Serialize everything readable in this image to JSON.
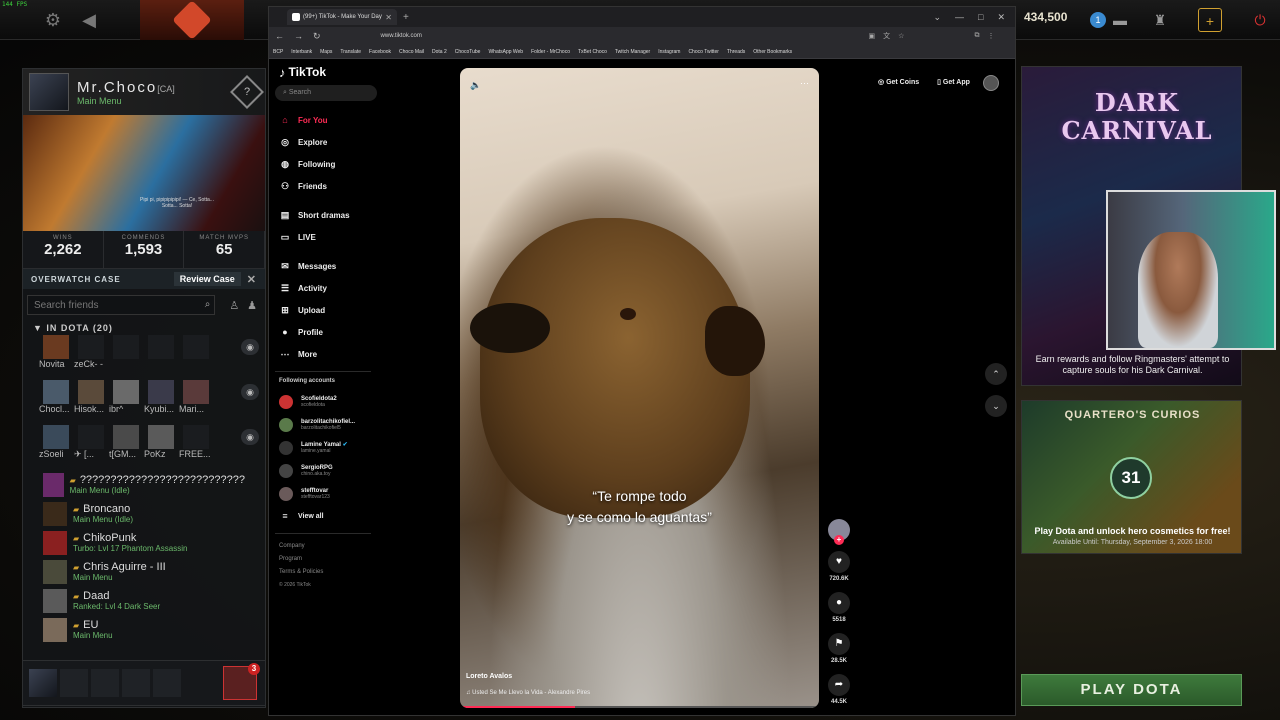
{
  "fps": "144 FPS",
  "dota": {
    "gold": "434,500",
    "party_count": "1",
    "profile": {
      "name": "Mr.Choco",
      "tag": "[CA]",
      "status": "Main Menu",
      "rank": "?"
    },
    "banner_text": "Pipi pi, pipipipipipi! — Ce, Sotta... Sotta... Sotta!",
    "stats": [
      {
        "label": "WINS",
        "value": "2,262"
      },
      {
        "label": "COMMENDS",
        "value": "1,593"
      },
      {
        "label": "MATCH MVPS",
        "value": "65"
      }
    ],
    "overwatch": {
      "label": "OVERWATCH CASE",
      "button": "Review Case"
    },
    "search_placeholder": "Search friends",
    "in_dota": "IN DOTA (20)",
    "grid_rows": [
      [
        "Novita",
        "zeCk- -",
        "",
        "",
        ""
      ],
      [
        "Chocl...",
        "Hisok...",
        "ibr^",
        "Kyubi...",
        "Mari..."
      ],
      [
        "zSoeli",
        "✈ [...",
        "t[GM...",
        "PoKz",
        "FREE..."
      ]
    ],
    "friends": [
      {
        "name": "???????????????????????????",
        "status": "Main Menu (Idle)"
      },
      {
        "name": "Broncano",
        "status": "Main Menu (Idle)"
      },
      {
        "name": "ChikoPunk",
        "status": "Turbo: Lvl 17 Phantom Assassin"
      },
      {
        "name": "Chris Aguirre - III",
        "status": "Main Menu"
      },
      {
        "name": "Daad",
        "status": "Ranked: Lvl 4 Dark Seer"
      },
      {
        "name": "EU",
        "status": "Main Menu"
      }
    ],
    "party_badge": "3",
    "carnival": {
      "title": "DARK CARNIVAL",
      "subtitle": "Earn rewards and follow Ringmasters' attempt to capture souls for his Dark Carnival."
    },
    "curios": {
      "title": "QUARTERO'S CURIOS",
      "badge": "31",
      "desc": "Play Dota and unlock hero cosmetics for free!",
      "available": "Available Until: Thursday, September 3, 2026 18:00"
    },
    "play_button": "PLAY DOTA"
  },
  "browser": {
    "tab_title": "(99+) TikTok - Make Your Day",
    "url": "www.tiktok.com",
    "bookmarks": [
      "BCP",
      "Interbank",
      "Maps",
      "Translate",
      "Facebook",
      "Choco Mail",
      "Dota 2",
      "ChocoTube",
      "WhatsApp Web",
      "Folder - MrChoco",
      "TxBet Choco",
      "Twitch Manager",
      "Instagram",
      "Choco Twitter",
      "Threads",
      "Other Bookmarks"
    ]
  },
  "tiktok": {
    "logo": "TikTok",
    "search_placeholder": "Search",
    "nav": [
      {
        "label": "For You",
        "icon": "home-icon"
      },
      {
        "label": "Explore",
        "icon": "compass-icon"
      },
      {
        "label": "Following",
        "icon": "following-icon"
      },
      {
        "label": "Friends",
        "icon": "friends-icon"
      },
      {
        "label": "Short dramas",
        "icon": "drama-icon"
      },
      {
        "label": "LIVE",
        "icon": "live-icon"
      },
      {
        "label": "Messages",
        "icon": "messages-icon"
      },
      {
        "label": "Activity",
        "icon": "activity-icon"
      },
      {
        "label": "Upload",
        "icon": "upload-icon"
      },
      {
        "label": "Profile",
        "icon": "profile-icon"
      },
      {
        "label": "More",
        "icon": "more-icon"
      }
    ],
    "following_header": "Following accounts",
    "accounts": [
      {
        "name": "Scofieldota2",
        "handle": "scofieldota"
      },
      {
        "name": "barzolitachikofiel...",
        "handle": "barzolitachikofiel5"
      },
      {
        "name": "Lamine Yamal",
        "handle": "lamine.yamal"
      },
      {
        "name": "SergioRPG",
        "handle": "chino.aka.toy"
      },
      {
        "name": "stefftovar",
        "handle": "stefftovar123"
      }
    ],
    "view_all": "View all",
    "footer": [
      "Company",
      "Program",
      "Terms & Policies"
    ],
    "copyright": "© 2026 TikTok",
    "get_coins": "Get Coins",
    "get_app": "Get App",
    "video": {
      "caption_1": "“Te rompe todo",
      "caption_2": "y se como lo aguantas”",
      "author": "Loreto Avalos",
      "music": "♫  Usted Se Me Llevo la Vida - Alexandre Pires",
      "progress": 0.32
    },
    "likes": "720.6K",
    "comments": "5518",
    "saves": "28.5K",
    "shares": "44.5K"
  }
}
